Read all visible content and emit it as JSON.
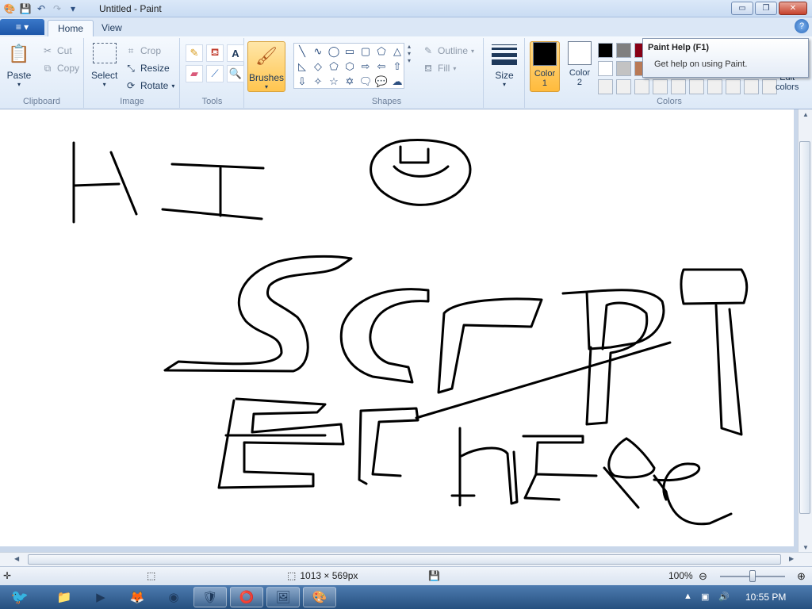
{
  "window": {
    "title": "Untitled - Paint",
    "minimize": "▭",
    "restore": "❐",
    "close": "✕"
  },
  "tabs": {
    "file_menu": "≡ ▾",
    "home": "Home",
    "view": "View"
  },
  "ribbon": {
    "clipboard": {
      "label": "Clipboard",
      "paste": "Paste",
      "cut": "Cut",
      "copy": "Copy"
    },
    "image": {
      "label": "Image",
      "select": "Select",
      "crop": "Crop",
      "resize": "Resize",
      "rotate": "Rotate"
    },
    "tools": {
      "label": "Tools"
    },
    "brushes": "Brushes",
    "shapes": {
      "label": "Shapes",
      "outline": "Outline",
      "fill": "Fill"
    },
    "size": "Size",
    "colors": {
      "label": "Colors",
      "color1": "Color\n1",
      "color2": "Color\n2",
      "color1_value": "#000000",
      "color2_value": "#ffffff",
      "edit": "Edit\ncolors",
      "palette": [
        "#000000",
        "#7f7f7f",
        "#880015",
        "#ed1c24",
        "#ff7f27",
        "#fff200",
        "#22b14c",
        "#00a2e8",
        "#3f48cc",
        "#a349a4",
        "#ffffff",
        "#c3c3c3",
        "#b97a57",
        "#ffaec9",
        "#ffc90e",
        "#efe4b0",
        "#b5e61d",
        "#99d9ea",
        "#7092be",
        "#c8bfe7",
        "#f0f0f0",
        "#f0f0f0",
        "#f0f0f0",
        "#f0f0f0",
        "#f0f0f0",
        "#f0f0f0",
        "#f0f0f0",
        "#f0f0f0",
        "#f0f0f0",
        "#f0f0f0"
      ]
    }
  },
  "tooltip": {
    "title": "Paint Help (F1)",
    "description": "Get help on using Paint."
  },
  "statusbar": {
    "dimensions": "1013 × 569px",
    "zoom": "100%"
  },
  "taskbar": {
    "clock": "10:55 PM",
    "items": [
      "angry-birds",
      "explorer",
      "media-player",
      "firefox",
      "chrome",
      "program",
      "opera",
      "slides",
      "paint"
    ]
  }
}
